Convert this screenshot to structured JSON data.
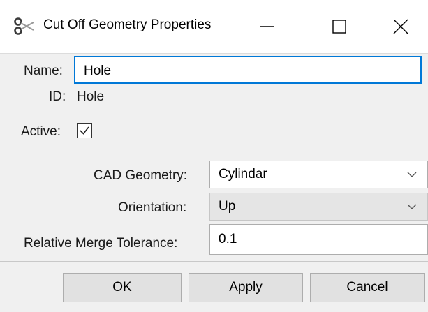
{
  "window": {
    "title": "Cut Off Geometry Properties",
    "icon": "scissors-icon",
    "controls": [
      "minimize-icon",
      "maximize-icon",
      "close-icon"
    ]
  },
  "form": {
    "name_label": "Name:",
    "name_value": "Hole",
    "id_label": "ID:",
    "id_value": "Hole",
    "active_label": "Active:",
    "active_checked": true,
    "cad_label": "CAD Geometry:",
    "cad_value": "Cylindar",
    "orientation_label": "Orientation:",
    "orientation_value": "Up",
    "merge_label": "Relative Merge Tolerance:",
    "merge_value": "0.1"
  },
  "buttons": {
    "ok": "OK",
    "apply": "Apply",
    "cancel": "Cancel"
  },
  "colors": {
    "focus_border": "#0078d7",
    "dialog_bg": "#f0f0f0",
    "button_bg": "#e1e1e1"
  }
}
